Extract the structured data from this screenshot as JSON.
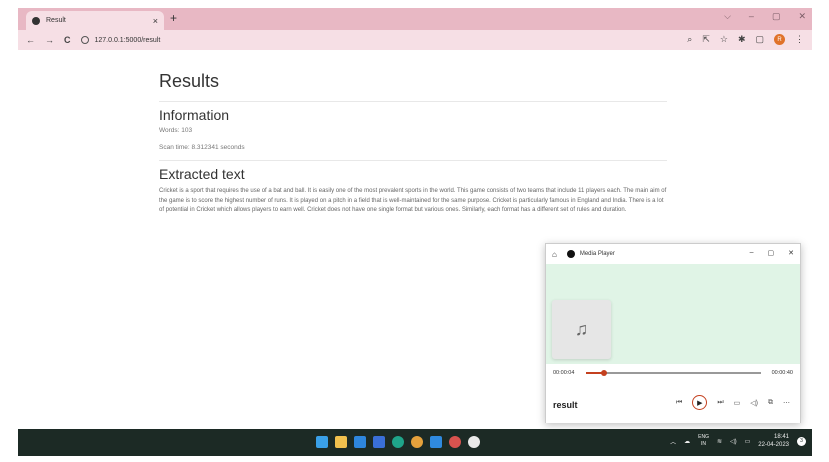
{
  "browser": {
    "tab_title": "Result",
    "tab_close": "×",
    "new_tab": "+",
    "url": "127.0.0.1:5000/result",
    "window_controls": [
      "⌵",
      "–",
      "▢",
      "✕"
    ],
    "nav": {
      "back": "←",
      "forward": "→",
      "reload": "C"
    },
    "toolbar_icons": [
      "search-icon",
      "share-icon",
      "star-icon",
      "extensions-icon",
      "sidebar-icon",
      "profile-icon",
      "menu-icon"
    ],
    "profile_initial": "R",
    "theme_color": "#e8b8c4"
  },
  "page": {
    "title": "Results",
    "section1_heading": "Information",
    "words": "Words: 103",
    "scan_time": "Scan time: 8.312341 seconds",
    "section2_heading": "Extracted text",
    "extracted_text": "Cricket is a sport that requires the use of a bat and ball. It is easily one of the most prevalent sports in the world. This game consists of two teams that include 11 players each. The main aim of the game is to score the highest number of runs. It is played on a pitch in a field that is well-maintained for the same purpose. Cricket is particularly famous in England and India. There is a lot of potential in Cricket which allows players to earn well. Cricket does not have one single format but various ones. Similarly, each format has a different set of rules and duration."
  },
  "media_player": {
    "app_title": "Media Player",
    "window_controls": [
      "–",
      "▢",
      "✕"
    ],
    "elapsed": "00:00:04",
    "duration": "00:00:40",
    "progress": 0.1,
    "track_name": "result",
    "accent": "#c4401f",
    "art_bg": "#e0f4e6"
  },
  "taskbar": {
    "lang_line1": "ENG",
    "lang_line2": "IN",
    "time": "18:41",
    "date": "22-04-2023",
    "notifications": "3",
    "app_icons": [
      {
        "name": "start-icon",
        "color": "#3aa0e8"
      },
      {
        "name": "file-explorer-icon",
        "color": "#f2c14e"
      },
      {
        "name": "mail-icon",
        "color": "#2e86de"
      },
      {
        "name": "photos-icon",
        "color": "#3a6fd8"
      },
      {
        "name": "edge-icon",
        "color": "#1fa58a"
      },
      {
        "name": "chrome-icon",
        "color": "#e6a23c"
      },
      {
        "name": "vscode-icon",
        "color": "#2f8ae0"
      },
      {
        "name": "chrome-profile-icon",
        "color": "#d9534f"
      },
      {
        "name": "media-player-icon",
        "color": "#e9e9e9"
      }
    ]
  }
}
